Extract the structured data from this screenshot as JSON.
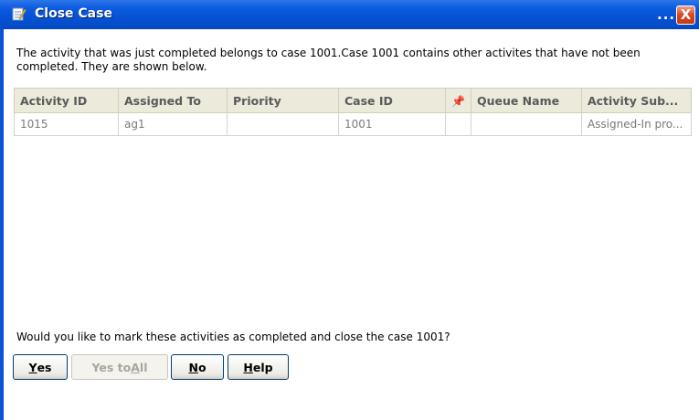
{
  "window": {
    "title": "Close Case",
    "title_icon": "edit-document-icon",
    "overflow_label": "...",
    "close_label": "X"
  },
  "message": "The activity that was just completed belongs to case 1001.Case 1001 contains other activites that have not been completed. They are shown below.",
  "table": {
    "columns": [
      "Activity ID",
      "Assigned To",
      "Priority",
      "Case ID",
      "",
      "Queue Name",
      "Activity Sub..."
    ],
    "pin_icon": "pin-icon",
    "rows": [
      [
        "1015",
        "ag1",
        "",
        "1001",
        "",
        "",
        "Assigned-In pro..."
      ]
    ]
  },
  "question": "Would you like to mark these activities as completed and close the case 1001?",
  "buttons": {
    "yes": {
      "mnemonic": "Y",
      "rest": "es"
    },
    "yes_to_all": {
      "before": "Yes to ",
      "mnemonic": "A",
      "after": "ll",
      "disabled": true
    },
    "no": {
      "mnemonic": "N",
      "rest": "o"
    },
    "help": {
      "mnemonic": "H",
      "rest": "elp"
    }
  },
  "colors": {
    "titlebar": "#0652d4",
    "close_button": "#d9481f",
    "grid_header": "#ebeadb",
    "button_border": "#003c74"
  }
}
